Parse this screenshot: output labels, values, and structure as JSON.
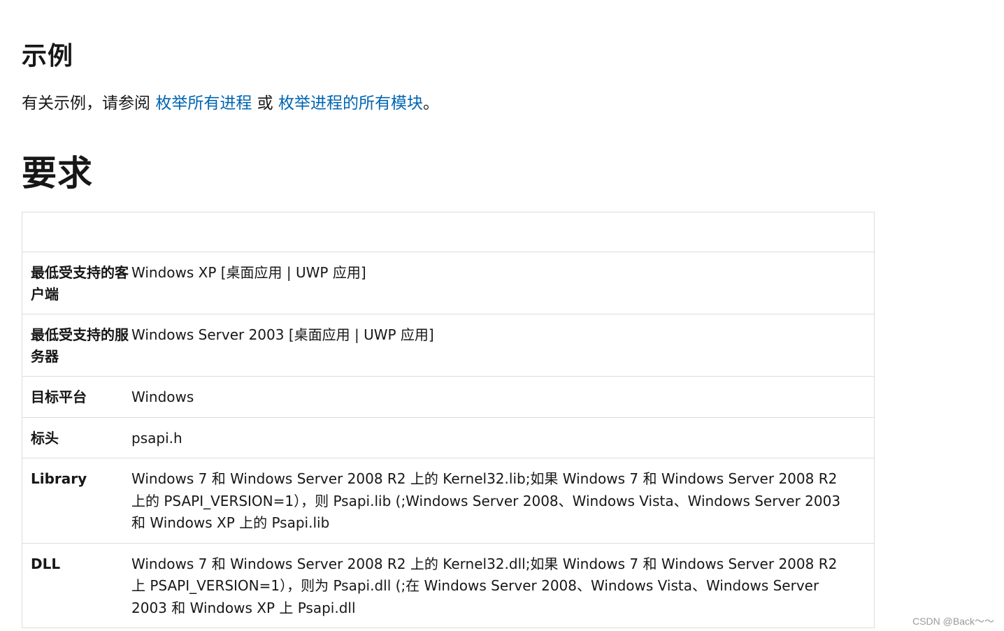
{
  "example": {
    "heading": "示例",
    "text_before": "有关示例，请参阅 ",
    "link1": "枚举所有进程",
    "text_between": " 或 ",
    "link2": "枚举进程的所有模块",
    "text_after": "。"
  },
  "requirements": {
    "heading": "要求",
    "header_cells": [
      "",
      ""
    ],
    "rows": [
      {
        "key": "最低受支持的客户端",
        "value": "Windows XP [桌面应用 | UWP 应用]"
      },
      {
        "key": "最低受支持的服务器",
        "value": "Windows Server 2003 [桌面应用 | UWP 应用]"
      },
      {
        "key": "目标平台",
        "value": "Windows"
      },
      {
        "key": "标头",
        "value": "psapi.h"
      },
      {
        "key": "Library",
        "value": "Windows 7 和 Windows Server 2008 R2 上的 Kernel32.lib;如果 Windows 7 和 Windows Server 2008 R2 上的 PSAPI_VERSION=1），则 Psapi.lib (;Windows Server 2008、Windows Vista、Windows Server 2003 和 Windows XP 上的 Psapi.lib"
      },
      {
        "key": "DLL",
        "value": "Windows 7 和 Windows Server 2008 R2 上的 Kernel32.dll;如果 Windows 7 和 Windows Server 2008 R2 上 PSAPI_VERSION=1），则为 Psapi.dll (;在 Windows Server 2008、Windows Vista、Windows Server 2003 和 Windows XP 上 Psapi.dll"
      }
    ]
  },
  "watermark": "CSDN @Back～～"
}
